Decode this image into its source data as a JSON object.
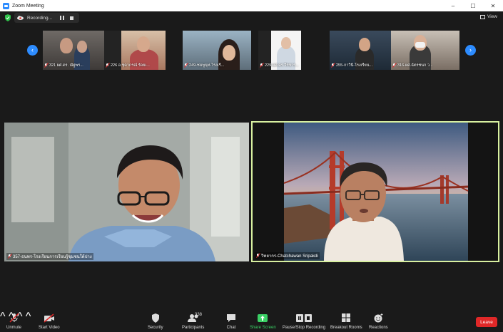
{
  "window": {
    "title": "Zoom Meeting",
    "controls": [
      "–",
      "☐",
      "✕"
    ]
  },
  "status": {
    "recording_label": "Recording...",
    "view_label": "View"
  },
  "thumbnails": [
    {
      "name": "321 ผศ.ดร. ณัฐพร..."
    },
    {
      "name": "226 อ.ชุดากรณ์ ร้อยเ..."
    },
    {
      "name": "249-ชมพูนุท-โรงเรี..."
    },
    {
      "name": "229-ผศ.ดร.วีรชาร..."
    },
    {
      "name": "255-กาวีนี-โรงเรียน..."
    },
    {
      "name": "316-ผศ.ฉัตรชนก ว..."
    }
  ],
  "videos": {
    "left_name": "357-ธนพร-โรงเรียนการเรียนรู้ชุมชนใต้ปาง",
    "right_name": "วิทยากร-Chatchawan Sripakdi"
  },
  "toolbar": {
    "unmute": "Unmute",
    "start_video": "Start Video",
    "security": "Security",
    "participants": "Participants",
    "participant_count": "338",
    "chat": "Chat",
    "share_screen": "Share Screen",
    "pause_stop_recording": "Pause/Stop Recording",
    "breakout_rooms": "Breakout Rooms",
    "reactions": "Reactions",
    "leave": "Leave"
  },
  "colors": {
    "accent_blue": "#2d8cff",
    "leave_red": "#e02828",
    "share_green": "#3ad065",
    "active_speaker_border": "#d8f0a0"
  }
}
